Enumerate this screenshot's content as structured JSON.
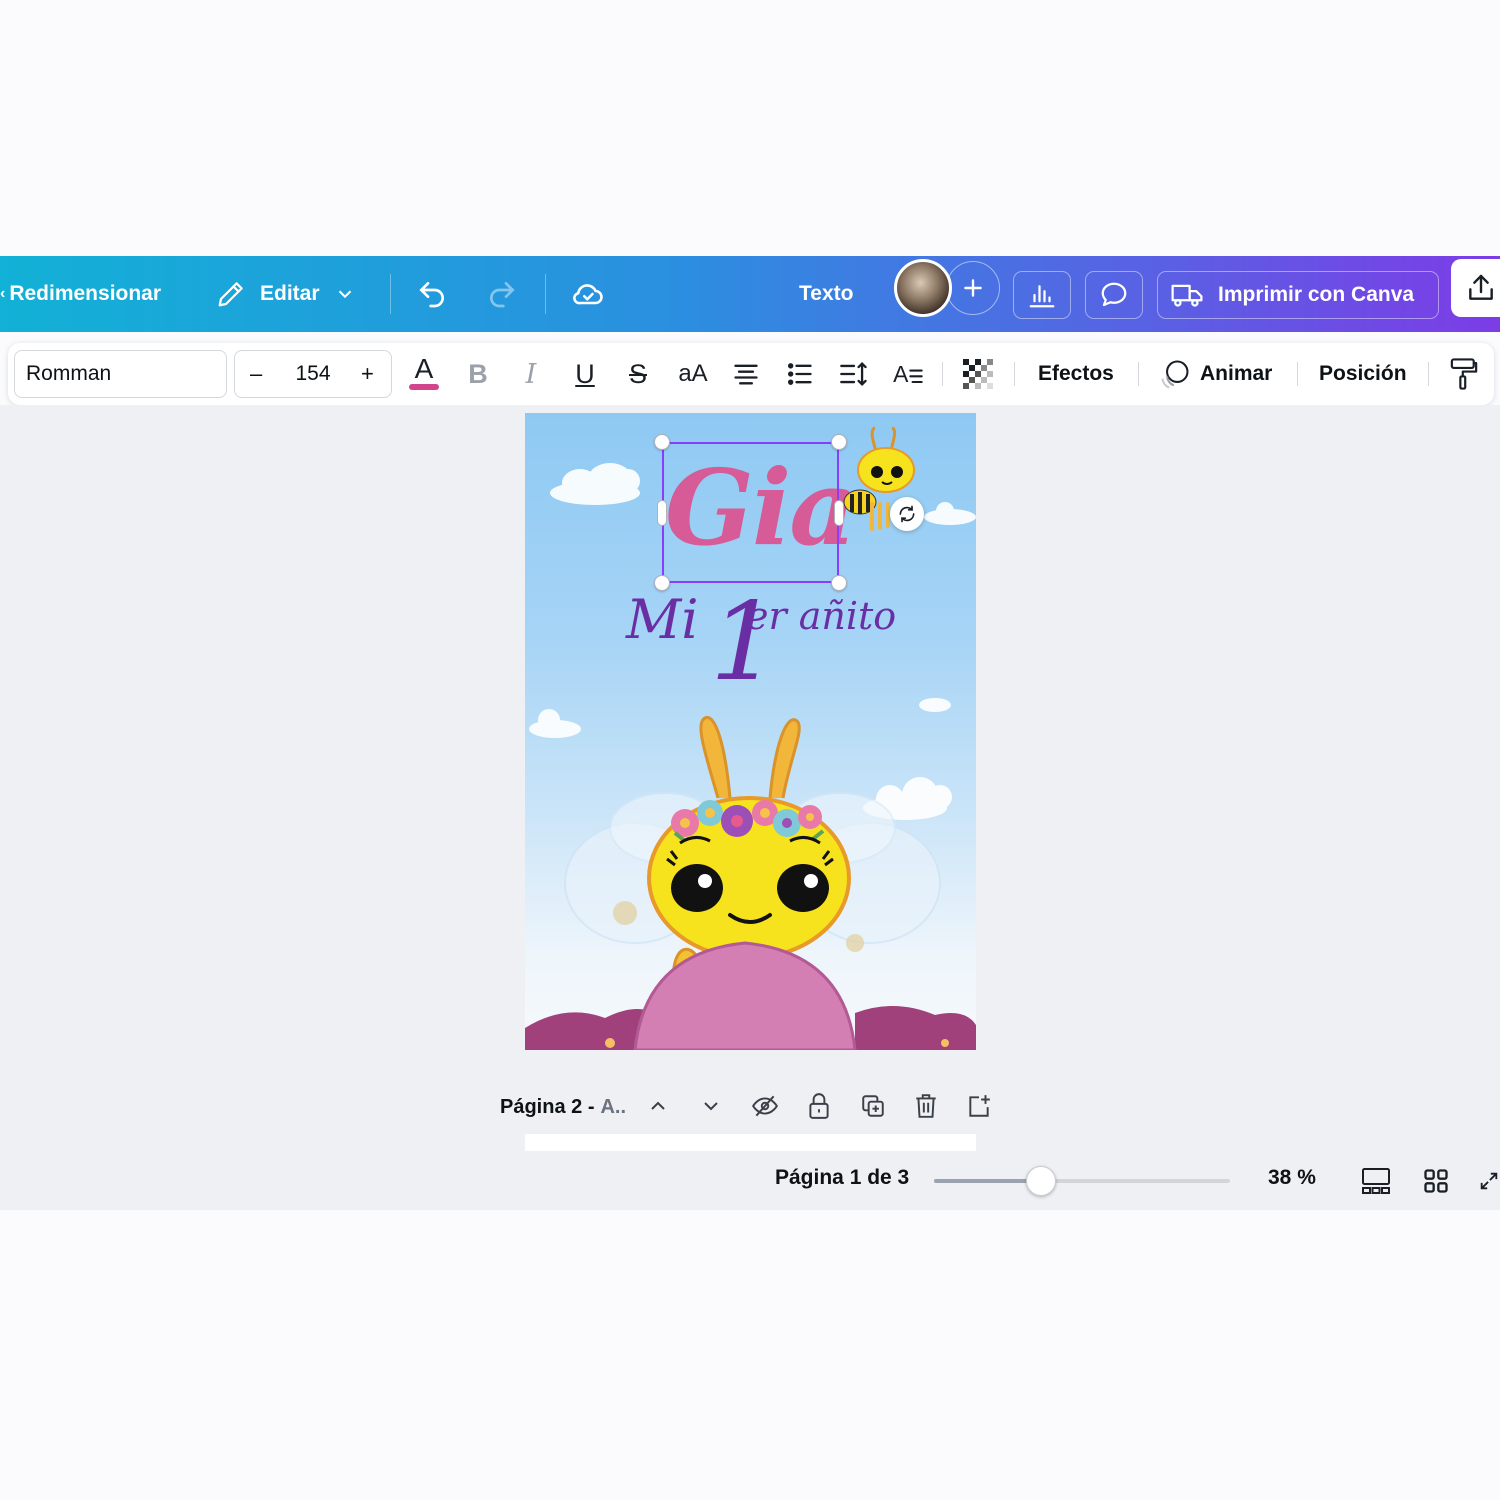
{
  "topbar": {
    "resize_label": "Redimensionar",
    "edit_label": "Editar",
    "mode_label": "Texto",
    "print_label": "Imprimir con Canva"
  },
  "toolbar": {
    "font_name": "Romman",
    "font_size": "154",
    "size_minus": "–",
    "size_plus": "+",
    "case_label": "aA",
    "effects_label": "Efectos",
    "animate_label": "Animar",
    "position_label": "Posición"
  },
  "design": {
    "name_text": "Gia",
    "mi_text": "Mi",
    "number_text": "1",
    "subtitle_text": "er añito"
  },
  "pagebar": {
    "page_label": "Página 2 -",
    "page_title_truncated": "A.."
  },
  "footer": {
    "page_count": "Página 1 de 3",
    "zoom_label": "38 %",
    "zoom_fraction": 0.36
  },
  "colors": {
    "accent_purple": "#8b3dff",
    "text_pink": "#d65b96",
    "text_purple": "#6a2ea4",
    "font_color_underline": "#d0458c"
  }
}
